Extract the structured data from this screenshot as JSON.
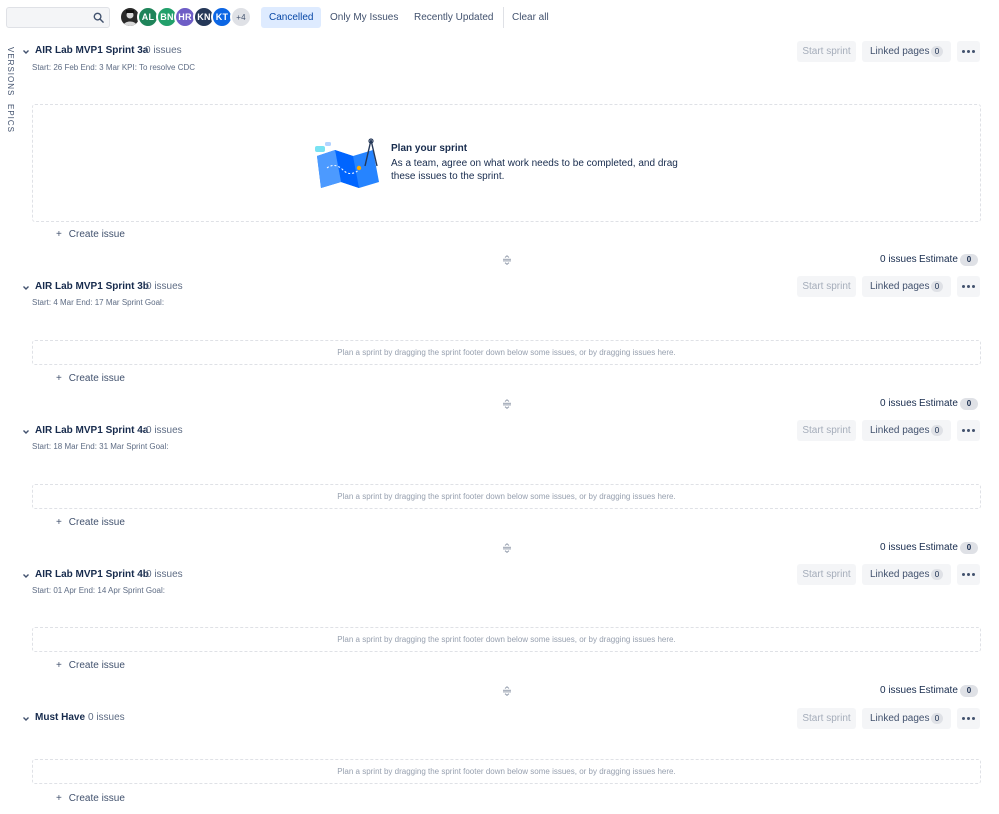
{
  "toolbar": {
    "search_value": "",
    "avatars": [
      {
        "initials": "",
        "color": "#2a2a2a",
        "photo": true
      },
      {
        "initials": "AL",
        "color": "#1f845a"
      },
      {
        "initials": "BN",
        "color": "#22a06b"
      },
      {
        "initials": "HR",
        "color": "#6e5dc6"
      },
      {
        "initials": "KN",
        "color": "#253858"
      },
      {
        "initials": "KT",
        "color": "#0c66e4"
      },
      {
        "initials": "+4",
        "color": "#dfe1e6"
      }
    ],
    "filters": [
      "Cancelled",
      "Only My Issues",
      "Recently Updated"
    ],
    "clear_all": "Clear all"
  },
  "side_tabs": [
    "VERSIONS",
    "EPICS"
  ],
  "common": {
    "start_sprint": "Start sprint",
    "linked_pages": "Linked pages",
    "linked_count": "0",
    "create_issue": "Create issue",
    "plus": "+",
    "estimate": "Estimate",
    "drop_hint": "Plan a sprint by dragging the sprint footer down below some issues, or by dragging issues here."
  },
  "plan": {
    "title": "Plan your sprint",
    "text": "As a team, agree on what work needs to be completed, and drag these issues to the sprint."
  },
  "sprints": [
    {
      "name": "AIR Lab MVP1 Sprint 3a",
      "count": "0 issues",
      "dates": "Start: 26 Feb End: 3 Mar KPI: To resolve CDC",
      "footer_issues": "0 issues",
      "estimate_value": "0"
    },
    {
      "name": "AIR Lab MVP1 Sprint 3b",
      "count": "0 issues",
      "dates": "Start: 4 Mar End: 17 Mar Sprint Goal:",
      "footer_issues": "0 issues",
      "estimate_value": "0"
    },
    {
      "name": "AIR Lab MVP1 Sprint 4a",
      "count": "0 issues",
      "dates": "Start: 18 Mar End: 31 Mar Sprint Goal:",
      "footer_issues": "0 issues",
      "estimate_value": "0"
    },
    {
      "name": "AIR Lab MVP1 Sprint 4b",
      "count": "0 issues",
      "dates": "Start: 01 Apr End: 14 Apr Sprint Goal:",
      "footer_issues": "0 issues",
      "estimate_value": "0"
    },
    {
      "name": "Must Have",
      "count": "0 issues",
      "dates": "",
      "footer_issues": "",
      "estimate_value": ""
    }
  ]
}
